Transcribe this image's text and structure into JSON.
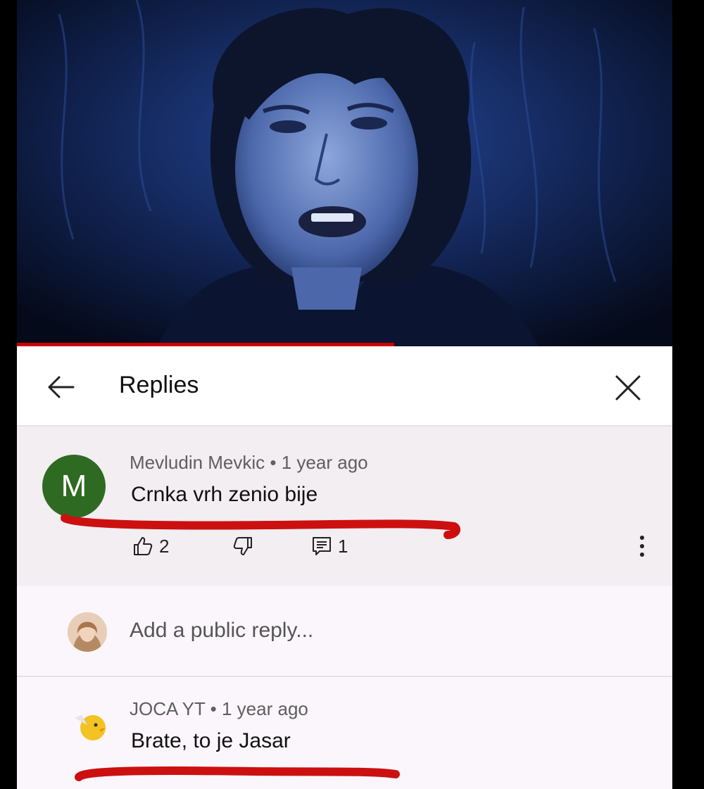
{
  "header": {
    "title": "Replies"
  },
  "comment": {
    "avatar_letter": "M",
    "author": "Mevludin Mevkic",
    "separator": "•",
    "time": "1 year ago",
    "text": "Crnka vrh zenio bije",
    "likes": "2",
    "replies": "1"
  },
  "reply_box": {
    "placeholder": "Add a public reply..."
  },
  "reply": {
    "author": "JOCA YT",
    "separator": "•",
    "time": "1 year ago",
    "text": "Brate, to je Jasar"
  },
  "colors": {
    "avatar_green": "#2f6a22",
    "annotation_red": "#cc1010",
    "progress_red": "#cc0000"
  },
  "icons": {
    "back": "arrow-left-icon",
    "close": "close-icon",
    "like": "thumbs-up-icon",
    "dislike": "thumbs-down-icon",
    "reply": "comment-icon",
    "more": "more-vertical-icon"
  }
}
